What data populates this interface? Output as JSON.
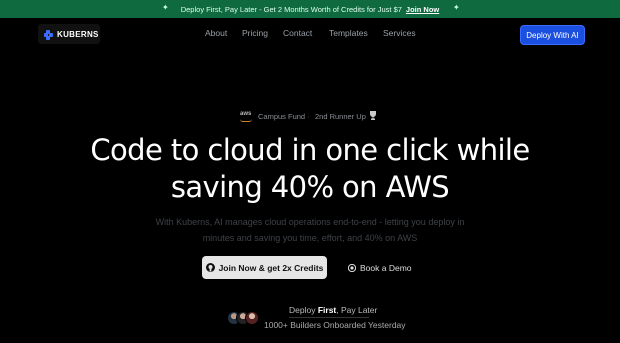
{
  "banner": {
    "left_star": "✦",
    "right_star": "✦",
    "text": "Deploy First, Pay Later - Get 2 Months Worth of Credits for Just $7",
    "link": "Join Now"
  },
  "nav": {
    "logo": "KUBERNS",
    "links": [
      "About",
      "Pricing",
      "Contact",
      "Templates",
      "Services"
    ],
    "cta": "Deploy With AI"
  },
  "award": {
    "aws": "aws",
    "campus": "Campus Fund",
    "separator": "·",
    "runner": "2nd Runner Up"
  },
  "hero": {
    "line1": "Code to cloud in one click while",
    "line2": "saving 40% on AWS",
    "sub_line1": "With Kuberns, AI manages cloud operations end-to-end - letting you deploy in",
    "sub_line2": "minutes and saving you time, effort, and 40% on AWS"
  },
  "actions": {
    "join": "Join Now & get 2x Credits",
    "demo": "Book a Demo"
  },
  "footer": {
    "deploy_pre": "Deploy ",
    "deploy_bold": "First",
    "deploy_post": ", Pay Later",
    "builders": "1000+ Builders Onboarded Yesterday"
  },
  "colors": {
    "banner_bg": "#0f6a3f",
    "accent": "#1a4fe0"
  },
  "icons": [
    "star-icon",
    "kuberns-logo-icon",
    "aws-logo",
    "trophy-icon",
    "github-icon",
    "calendar-icon"
  ]
}
